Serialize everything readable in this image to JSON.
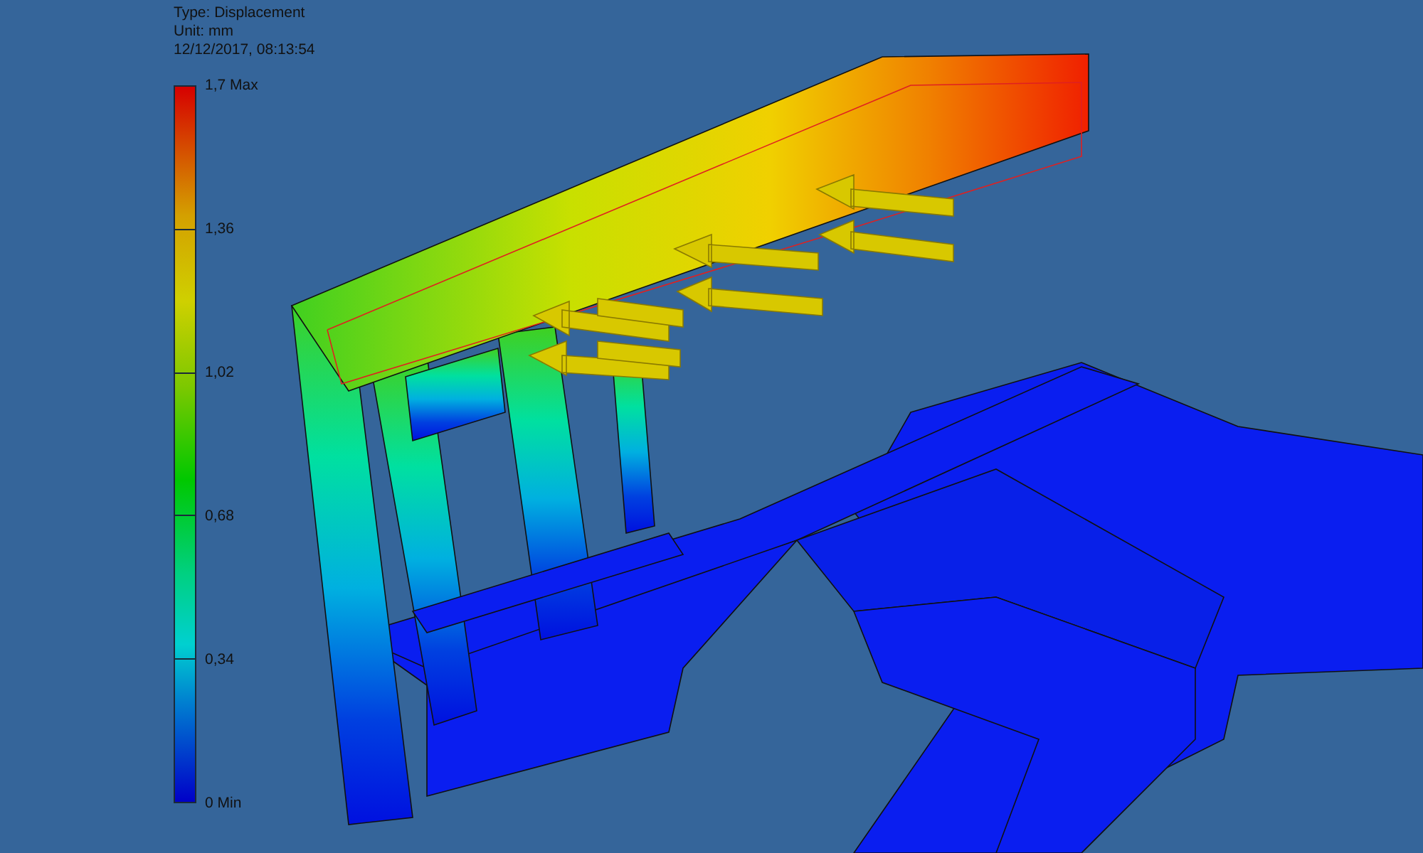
{
  "legend": {
    "type": "Type: Displacement",
    "unit": "Unit: mm",
    "timestamp": "12/12/2017, 08:13:54",
    "scale_labels": [
      "1,7 Max",
      "1,36",
      "1,02",
      "0,68",
      "0,34",
      "0 Min"
    ]
  }
}
